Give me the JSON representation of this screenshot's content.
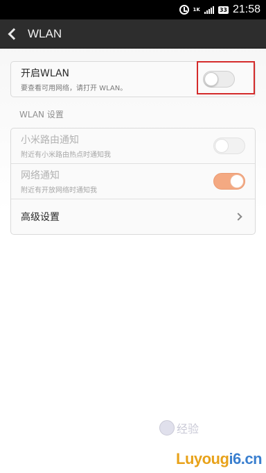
{
  "status_bar": {
    "speed": "1K",
    "battery": "33",
    "time": "21:58"
  },
  "header": {
    "title": "WLAN"
  },
  "wlan_toggle": {
    "title": "开启WLAN",
    "subtitle": "要查看可用网络，请打开 WLAN。",
    "enabled": false
  },
  "section_label": "WLAN 设置",
  "settings": {
    "xiaomi_router": {
      "title": "小米路由通知",
      "subtitle": "附近有小米路由热点时通知我",
      "enabled": false
    },
    "network_notify": {
      "title": "网络通知",
      "subtitle": "附近有开放网络时通知我",
      "enabled": true
    },
    "advanced": {
      "title": "高级设置"
    }
  },
  "watermark": {
    "text": "经验",
    "logo_part1": "Luyoug",
    "logo_part2": "i6.cn"
  },
  "colors": {
    "header_bg": "#2d2d2d",
    "toggle_on": "#f4a982",
    "highlight": "#d42a2a"
  }
}
